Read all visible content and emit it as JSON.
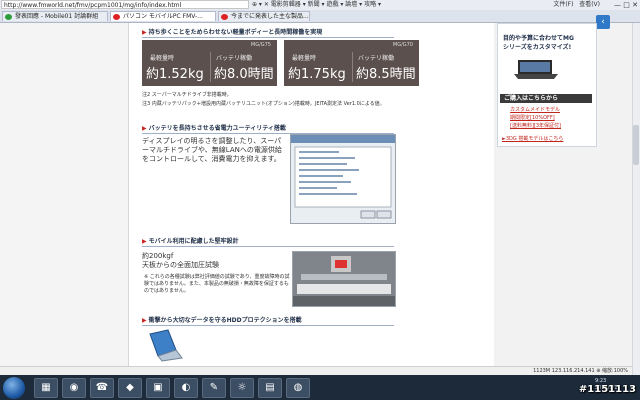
{
  "browser": {
    "url": "http://www.fmworld.net/fmv/pcpm1001/mg/info/index.html",
    "address_icons": "⊕ ▾ ✕  電影剪輯器 ▾  新聞 ▾  遊戲 ▾  論壇 ▾  攻略 ▾",
    "menu": {
      "file": "文件(F)",
      "view": "查看(V)"
    },
    "tabs": [
      {
        "label": "發表回應 - Mobile01 討論群組"
      },
      {
        "label": "パソコン モバイルPC FMV-..."
      },
      {
        "label": "今までに発表した主な製品..."
      }
    ]
  },
  "sections": {
    "weight": {
      "title": "持ち歩くことをためらわせない軽量ボディーと長時間稼働を実現",
      "left": {
        "model": "MG/G75",
        "weight_label": "最軽量時",
        "battery_label": "バッテリ稼働",
        "weight_value": "約1.52kg",
        "battery_value": "約8.0時間"
      },
      "right": {
        "model": "MG/G70",
        "weight_label": "最軽量時",
        "battery_label": "バッテリ稼働",
        "weight_value": "約1.75kg",
        "battery_value": "約8.5時間"
      },
      "note1": "注2 スーパーマルチドライブ非搭載時。",
      "note2": "注3 内蔵バッテリパック+増設用内蔵バッテリユニット(オプション)搭載時。JEITA測定法 Ver1.0による値。"
    },
    "battery": {
      "title": "バッテリを長持ちさせる省電力ユーティリティ搭載",
      "body": "ディスプレイの明るさを調整したり、スーパーマルチドライブや、無線LANへの電源供給をコントロールして、消費電力を抑えます。"
    },
    "mobile": {
      "title": "モバイル利用に配慮した堅牢設計",
      "heavy1": "約200kgf",
      "heavy2": "天板からの全面加圧試験",
      "note": "※ これらの各種試験は弊社評価値の試験であり、重度故障時の試験ではありません。また、本製品の無破損・無故障を保証するものではありません。"
    },
    "hdd": {
      "title": "衝撃から大切なデータを守るHDDプロテクションを搭載"
    }
  },
  "promo": {
    "line1": "目的や予算に合わせてMG",
    "line2": "シリーズをカスタマイズ!",
    "button": "ご購入はこちらから",
    "link1": "カスタムメイドモデル",
    "link2": "期間限定[10%OFF]",
    "link3": "[送料無料][3年保証付]",
    "link4": "►3DG 搭載モデルはこちら"
  },
  "status": {
    "text": "1123M 123.116.214.141  ⊕ 缩放:100%"
  },
  "taskbar": {
    "clock1": "9:23",
    "clock2": "2011/1/1"
  },
  "watermark": "#1151113"
}
